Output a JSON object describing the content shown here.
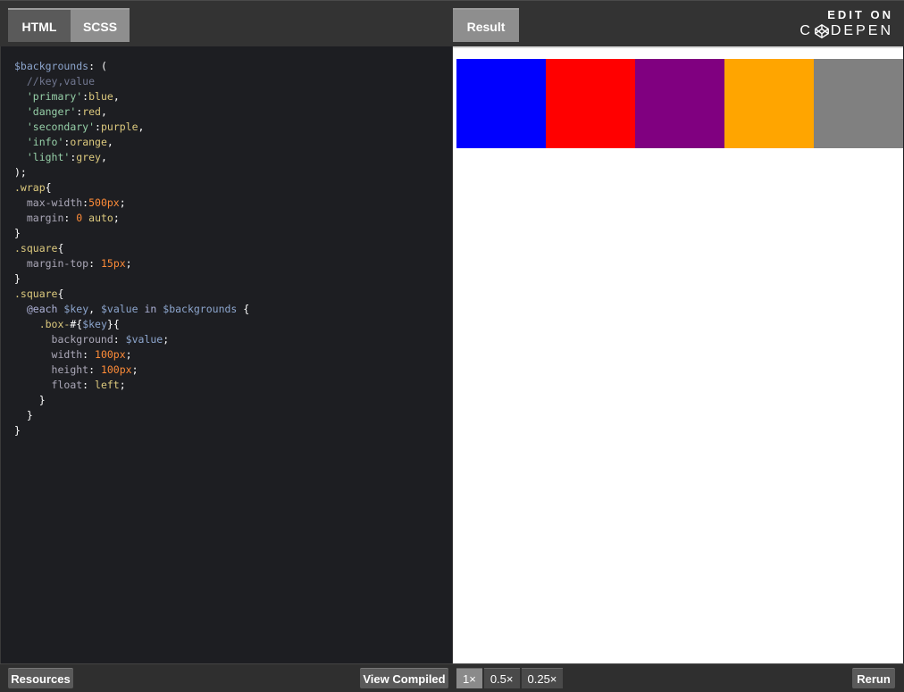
{
  "tabs": {
    "html": "HTML",
    "scss": "SCSS",
    "result": "Result"
  },
  "brand": {
    "line1": "EDIT ON",
    "line2_prefix": "C",
    "line2_suffix": "DEPEN"
  },
  "code_lines": [
    [
      [
        "c-var",
        "$backgrounds"
      ],
      [
        "c-txt",
        ": ("
      ]
    ],
    [
      [
        "c-txt",
        "  "
      ],
      [
        "c-cm",
        "//key,value"
      ]
    ],
    [
      [
        "c-txt",
        "  "
      ],
      [
        "c-str",
        "'primary'"
      ],
      [
        "c-txt",
        ":"
      ],
      [
        "c-val",
        "blue"
      ],
      [
        "c-txt",
        ","
      ]
    ],
    [
      [
        "c-txt",
        "  "
      ],
      [
        "c-str",
        "'danger'"
      ],
      [
        "c-txt",
        ":"
      ],
      [
        "c-val",
        "red"
      ],
      [
        "c-txt",
        ","
      ]
    ],
    [
      [
        "c-txt",
        "  "
      ],
      [
        "c-str",
        "'secondary'"
      ],
      [
        "c-txt",
        ":"
      ],
      [
        "c-val",
        "purple"
      ],
      [
        "c-txt",
        ","
      ]
    ],
    [
      [
        "c-txt",
        "  "
      ],
      [
        "c-str",
        "'info'"
      ],
      [
        "c-txt",
        ":"
      ],
      [
        "c-val",
        "orange"
      ],
      [
        "c-txt",
        ","
      ]
    ],
    [
      [
        "c-txt",
        "  "
      ],
      [
        "c-str",
        "'light'"
      ],
      [
        "c-txt",
        ":"
      ],
      [
        "c-val",
        "grey"
      ],
      [
        "c-txt",
        ","
      ]
    ],
    [
      [
        "c-txt",
        ");"
      ]
    ],
    [
      [
        "c-sel",
        ".wrap"
      ],
      [
        "c-txt",
        "{"
      ]
    ],
    [
      [
        "c-txt",
        "  "
      ],
      [
        "c-prop",
        "max-width"
      ],
      [
        "c-txt",
        ":"
      ],
      [
        "c-num",
        "500px"
      ],
      [
        "c-txt",
        ";"
      ]
    ],
    [
      [
        "c-txt",
        "  "
      ],
      [
        "c-prop",
        "margin"
      ],
      [
        "c-txt",
        ": "
      ],
      [
        "c-num",
        "0"
      ],
      [
        "c-txt",
        " "
      ],
      [
        "c-val",
        "auto"
      ],
      [
        "c-txt",
        ";"
      ]
    ],
    [
      [
        "c-txt",
        "}"
      ]
    ],
    [
      [
        "c-sel",
        ".square"
      ],
      [
        "c-txt",
        "{"
      ]
    ],
    [
      [
        "c-txt",
        "  "
      ],
      [
        "c-prop",
        "margin-top"
      ],
      [
        "c-txt",
        ": "
      ],
      [
        "c-num",
        "15px"
      ],
      [
        "c-txt",
        ";"
      ]
    ],
    [
      [
        "c-txt",
        "}"
      ]
    ],
    [
      [
        "c-sel",
        ".square"
      ],
      [
        "c-txt",
        "{"
      ]
    ],
    [
      [
        "c-txt",
        "  "
      ],
      [
        "c-at",
        "@each"
      ],
      [
        "c-txt",
        " "
      ],
      [
        "c-var",
        "$key"
      ],
      [
        "c-txt",
        ", "
      ],
      [
        "c-var",
        "$value"
      ],
      [
        "c-txt",
        " "
      ],
      [
        "c-at",
        "in"
      ],
      [
        "c-txt",
        " "
      ],
      [
        "c-var",
        "$backgrounds"
      ],
      [
        "c-txt",
        " {"
      ]
    ],
    [
      [
        "c-txt",
        "    "
      ],
      [
        "c-sel",
        ".box-"
      ],
      [
        "c-txt",
        "#{"
      ],
      [
        "c-var",
        "$key"
      ],
      [
        "c-txt",
        "}{"
      ]
    ],
    [
      [
        "c-txt",
        "      "
      ],
      [
        "c-prop",
        "background"
      ],
      [
        "c-txt",
        ": "
      ],
      [
        "c-var",
        "$value"
      ],
      [
        "c-txt",
        ";"
      ]
    ],
    [
      [
        "c-txt",
        "      "
      ],
      [
        "c-prop",
        "width"
      ],
      [
        "c-txt",
        ": "
      ],
      [
        "c-num",
        "100px"
      ],
      [
        "c-txt",
        ";"
      ]
    ],
    [
      [
        "c-txt",
        "      "
      ],
      [
        "c-prop",
        "height"
      ],
      [
        "c-txt",
        ": "
      ],
      [
        "c-num",
        "100px"
      ],
      [
        "c-txt",
        ";"
      ]
    ],
    [
      [
        "c-txt",
        "      "
      ],
      [
        "c-prop",
        "float"
      ],
      [
        "c-txt",
        ": "
      ],
      [
        "c-val",
        "left"
      ],
      [
        "c-txt",
        ";"
      ]
    ],
    [
      [
        "c-txt",
        "    }"
      ]
    ],
    [
      [
        "c-txt",
        "  }"
      ]
    ],
    [
      [
        "c-txt",
        "}"
      ]
    ]
  ],
  "result_boxes": [
    {
      "key": "primary",
      "color": "#0000ff"
    },
    {
      "key": "danger",
      "color": "#ff0000"
    },
    {
      "key": "secondary",
      "color": "#800080"
    },
    {
      "key": "info",
      "color": "#ffa500"
    },
    {
      "key": "light",
      "color": "#808080"
    }
  ],
  "bottom": {
    "resources": "Resources",
    "view_compiled": "View Compiled",
    "zoom_options": [
      "1×",
      "0.5×",
      "0.25×"
    ],
    "zoom_selected": "1×",
    "rerun": "Rerun"
  }
}
